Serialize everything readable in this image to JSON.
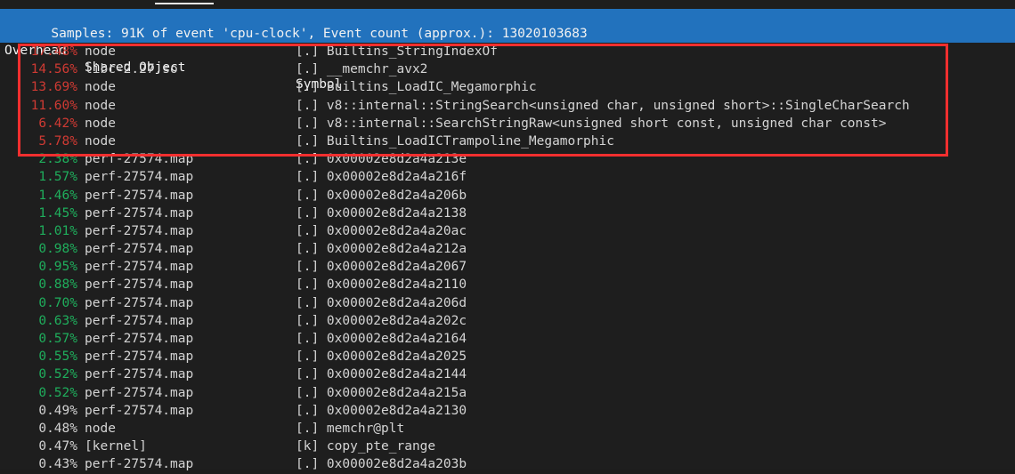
{
  "header": {
    "summary": "Samples: 91K of event 'cpu-clock', Event count (approx.): 13020103683",
    "columns": {
      "overhead": "Overhead",
      "shared_object": "Shared Object",
      "symbol": "Symbol"
    },
    "background_color": "#2272bd",
    "text_color": "#f2f2f2"
  },
  "colors": {
    "terminal_background": "#1e1e1e",
    "hot_percent": "#cf3a33",
    "warm_percent": "#1fae5c",
    "normal_text": "#d4d4d4",
    "highlight_box": "#f22f2f"
  },
  "annotation": {
    "highlight_box_label": "red-highlight-rectangle",
    "rows_covered": 6
  },
  "rows": [
    {
      "overhead": "17.48%",
      "shared_object": "node",
      "marker": "[.]",
      "symbol": "Builtins_StringIndexOf",
      "pct_class": "pct-red"
    },
    {
      "overhead": "14.56%",
      "shared_object": "libc-2.27.so",
      "marker": "[.]",
      "symbol": "__memchr_avx2",
      "pct_class": "pct-red"
    },
    {
      "overhead": "13.69%",
      "shared_object": "node",
      "marker": "[.]",
      "symbol": "Builtins_LoadIC_Megamorphic",
      "pct_class": "pct-red"
    },
    {
      "overhead": "11.60%",
      "shared_object": "node",
      "marker": "[.]",
      "symbol": "v8::internal::StringSearch<unsigned char, unsigned short>::SingleCharSearch",
      "pct_class": "pct-red"
    },
    {
      "overhead": "6.42%",
      "shared_object": "node",
      "marker": "[.]",
      "symbol": "v8::internal::SearchStringRaw<unsigned short const, unsigned char const>",
      "pct_class": "pct-red"
    },
    {
      "overhead": "5.78%",
      "shared_object": "node",
      "marker": "[.]",
      "symbol": "Builtins_LoadICTrampoline_Megamorphic",
      "pct_class": "pct-red"
    },
    {
      "overhead": "2.38%",
      "shared_object": "perf-27574.map",
      "marker": "[.]",
      "symbol": "0x00002e8d2a4a213e",
      "pct_class": "pct-green"
    },
    {
      "overhead": "1.57%",
      "shared_object": "perf-27574.map",
      "marker": "[.]",
      "symbol": "0x00002e8d2a4a216f",
      "pct_class": "pct-green"
    },
    {
      "overhead": "1.46%",
      "shared_object": "perf-27574.map",
      "marker": "[.]",
      "symbol": "0x00002e8d2a4a206b",
      "pct_class": "pct-green"
    },
    {
      "overhead": "1.45%",
      "shared_object": "perf-27574.map",
      "marker": "[.]",
      "symbol": "0x00002e8d2a4a2138",
      "pct_class": "pct-green"
    },
    {
      "overhead": "1.01%",
      "shared_object": "perf-27574.map",
      "marker": "[.]",
      "symbol": "0x00002e8d2a4a20ac",
      "pct_class": "pct-green"
    },
    {
      "overhead": "0.98%",
      "shared_object": "perf-27574.map",
      "marker": "[.]",
      "symbol": "0x00002e8d2a4a212a",
      "pct_class": "pct-green"
    },
    {
      "overhead": "0.95%",
      "shared_object": "perf-27574.map",
      "marker": "[.]",
      "symbol": "0x00002e8d2a4a2067",
      "pct_class": "pct-green"
    },
    {
      "overhead": "0.88%",
      "shared_object": "perf-27574.map",
      "marker": "[.]",
      "symbol": "0x00002e8d2a4a2110",
      "pct_class": "pct-green"
    },
    {
      "overhead": "0.70%",
      "shared_object": "perf-27574.map",
      "marker": "[.]",
      "symbol": "0x00002e8d2a4a206d",
      "pct_class": "pct-green"
    },
    {
      "overhead": "0.63%",
      "shared_object": "perf-27574.map",
      "marker": "[.]",
      "symbol": "0x00002e8d2a4a202c",
      "pct_class": "pct-green"
    },
    {
      "overhead": "0.57%",
      "shared_object": "perf-27574.map",
      "marker": "[.]",
      "symbol": "0x00002e8d2a4a2164",
      "pct_class": "pct-green"
    },
    {
      "overhead": "0.55%",
      "shared_object": "perf-27574.map",
      "marker": "[.]",
      "symbol": "0x00002e8d2a4a2025",
      "pct_class": "pct-green"
    },
    {
      "overhead": "0.52%",
      "shared_object": "perf-27574.map",
      "marker": "[.]",
      "symbol": "0x00002e8d2a4a2144",
      "pct_class": "pct-green"
    },
    {
      "overhead": "0.52%",
      "shared_object": "perf-27574.map",
      "marker": "[.]",
      "symbol": "0x00002e8d2a4a215a",
      "pct_class": "pct-green"
    },
    {
      "overhead": "0.49%",
      "shared_object": "perf-27574.map",
      "marker": "[.]",
      "symbol": "0x00002e8d2a4a2130",
      "pct_class": "pct-plain"
    },
    {
      "overhead": "0.48%",
      "shared_object": "node",
      "marker": "[.]",
      "symbol": "memchr@plt",
      "pct_class": "pct-plain"
    },
    {
      "overhead": "0.47%",
      "shared_object": "[kernel]",
      "marker": "[k]",
      "symbol": "copy_pte_range",
      "pct_class": "pct-plain"
    },
    {
      "overhead": "0.43%",
      "shared_object": "perf-27574.map",
      "marker": "[.]",
      "symbol": "0x00002e8d2a4a203b",
      "pct_class": "pct-plain"
    }
  ]
}
